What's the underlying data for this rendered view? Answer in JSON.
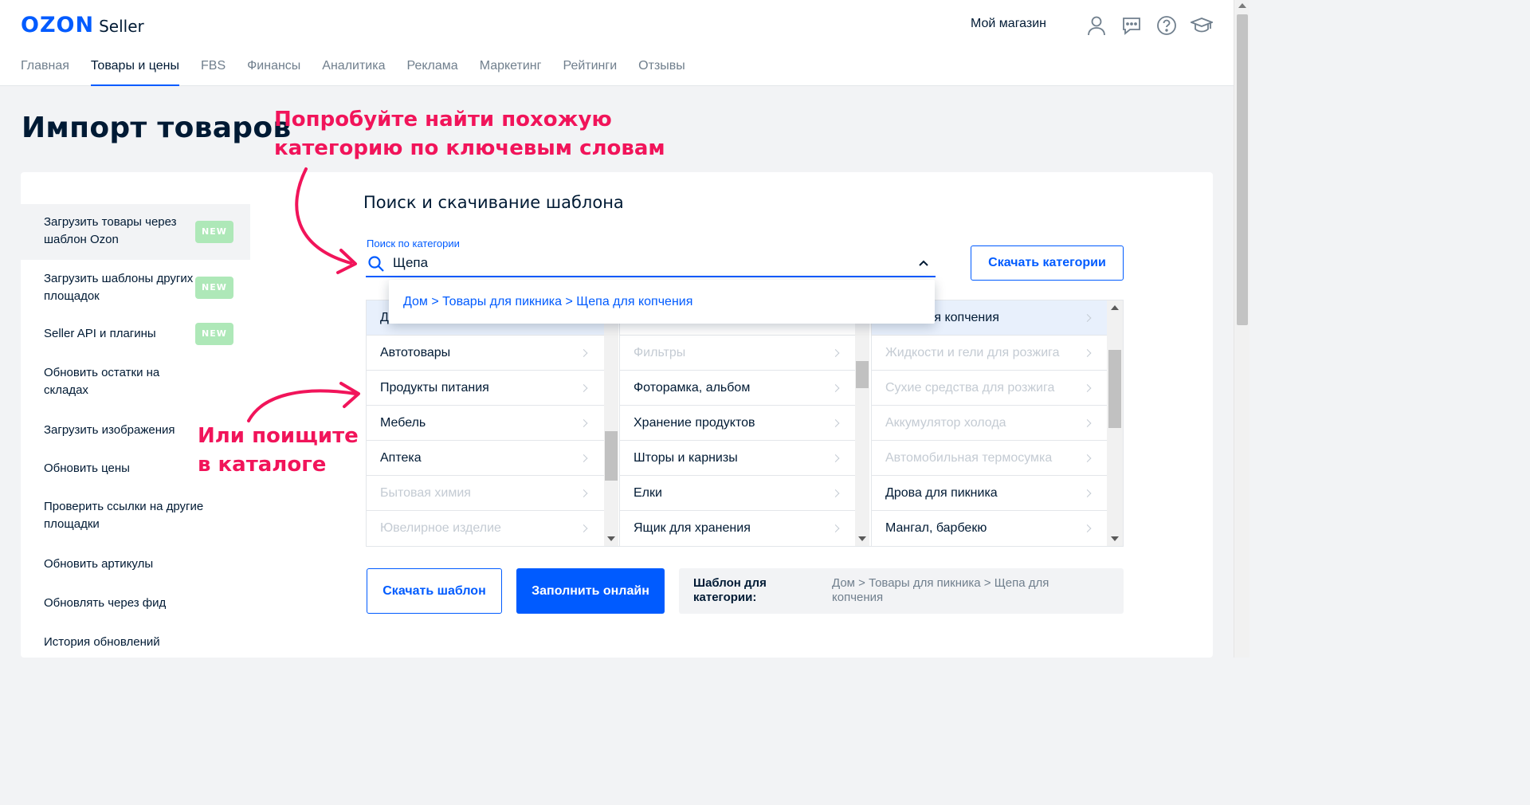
{
  "header": {
    "logo_brand": "OZON",
    "logo_product": "Seller",
    "store_label": "Мой магазин",
    "icons": [
      "user-icon",
      "chat-icon",
      "help-icon",
      "graduation-cap-icon"
    ]
  },
  "nav": {
    "tabs": [
      "Главная",
      "Товары и цены",
      "FBS",
      "Финансы",
      "Аналитика",
      "Реклама",
      "Маркетинг",
      "Рейтинги",
      "Отзывы"
    ],
    "active": "Товары и цены"
  },
  "page": {
    "title": "Импорт товаров"
  },
  "annotations": {
    "top_line1": "Попробуйте найти похожую",
    "top_line2": "категорию по ключевым словам",
    "left_line1": "Или поищите",
    "left_line2": "в каталоге"
  },
  "sidebar": {
    "items": [
      {
        "label": "Загрузить товары через шаблон Ozon",
        "badge": "NEW"
      },
      {
        "label": "Загрузить шаблоны других площадок",
        "badge": "NEW"
      },
      {
        "label": "Seller API и плагины",
        "badge": "NEW"
      },
      {
        "label": "Обновить остатки на складах"
      },
      {
        "label": "Загрузить изображения"
      },
      {
        "label": "Обновить цены"
      },
      {
        "label": "Проверить ссылки на другие площадки"
      },
      {
        "label": "Обновить артикулы"
      },
      {
        "label": "Обновлять через фид"
      },
      {
        "label": "История обновлений"
      }
    ]
  },
  "main": {
    "section_title": "Поиск и скачивание шаблона",
    "search_label": "Поиск по категории",
    "search_value": "Щепа",
    "download_categories": "Скачать категории",
    "suggestion": "Дом > Товары для пикника > Щепа для копчения",
    "catalog": {
      "col1": [
        {
          "label": "Д",
          "selected": true
        },
        {
          "label": "Автотовары"
        },
        {
          "label": "Продукты питания"
        },
        {
          "label": "Мебель"
        },
        {
          "label": "Аптека"
        },
        {
          "label": "Бытовая химия",
          "disabled": true
        },
        {
          "label": "Ювелирное изделие",
          "disabled": true
        }
      ],
      "col2": [
        {
          "label": "Фильтры",
          "disabled": true
        },
        {
          "label": "Фоторамка, альбом"
        },
        {
          "label": "Хранение продуктов"
        },
        {
          "label": "Шторы и карнизы"
        },
        {
          "label": "Елки"
        },
        {
          "label": "Ящик для хранения"
        }
      ],
      "col3": [
        {
          "label": "ля копчения",
          "selected": true
        },
        {
          "label": "Жидкости и гели для розжига",
          "disabled": true
        },
        {
          "label": "Сухие средства для розжига",
          "disabled": true
        },
        {
          "label": "Аккумулятор холода",
          "disabled": true
        },
        {
          "label": "Автомобильная термосумка",
          "disabled": true
        },
        {
          "label": "Дрова для пикника"
        },
        {
          "label": "Мангал, барбекю"
        }
      ]
    },
    "download_template": "Скачать шаблон",
    "fill_online": "Заполнить онлайн",
    "template_key": "Шаблон для категории:",
    "template_value": "Дом > Товары для пикника > Щепа для копчения"
  },
  "colors": {
    "brand": "#005bff",
    "annotation": "#f1145a",
    "badge": "#aee8b8"
  }
}
